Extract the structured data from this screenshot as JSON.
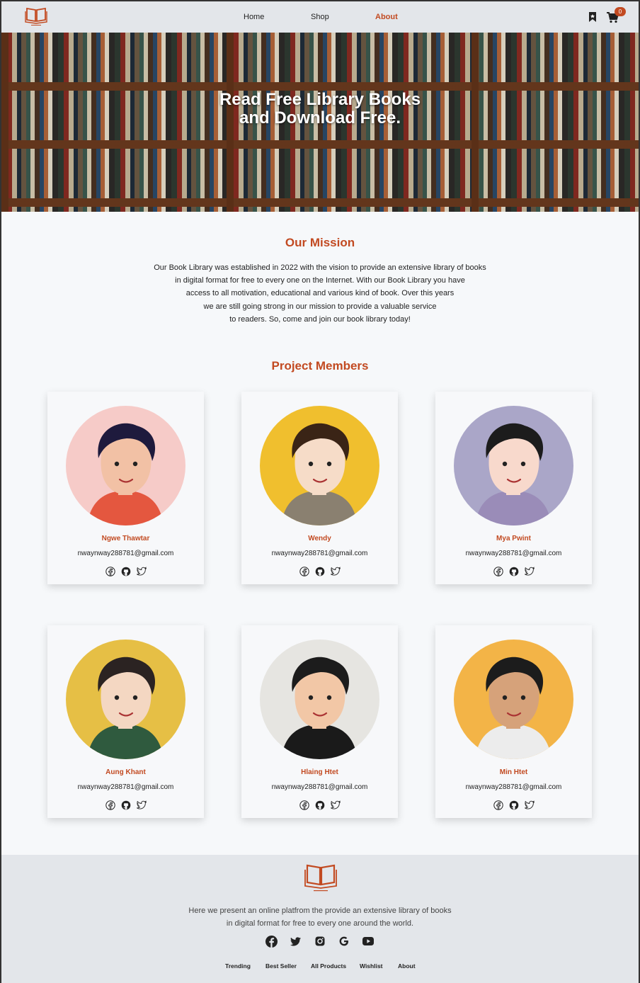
{
  "nav": {
    "links": [
      {
        "label": "Home"
      },
      {
        "label": "Shop"
      },
      {
        "label": "About"
      }
    ],
    "cart_count": "0",
    "icons": [
      "book-logo-icon",
      "bookmark-icon",
      "cart-icon"
    ]
  },
  "hero": {
    "title": "Read Free Library Books and Download Free."
  },
  "mission": {
    "title": "Our Mission",
    "lines": [
      "Our Book Library was established in 2022 with the vision to provide an extensive library of books",
      "in digital format for free to every one on the Internet. With our Book Library you have",
      "access to all motivation, educational and various kind of book. Over this years",
      "we are still going strong in our mission to provide a valuable service",
      "to readers. So, come and join our book library today!"
    ]
  },
  "members": {
    "title": "Project Members",
    "items": [
      {
        "name": "Ngwe Thawtar",
        "email": "nwaynway288781@gmail.com",
        "bg": "#f6cbc8"
      },
      {
        "name": "Wendy",
        "email": "nwaynway288781@gmail.com",
        "bg": "#f0bf2e"
      },
      {
        "name": "Mya Pwint",
        "email": "nwaynway288781@gmail.com",
        "bg": "#aaa6c8"
      },
      {
        "name": "Aung Khant",
        "email": "nwaynway288781@gmail.com",
        "bg": "#e6bf45"
      },
      {
        "name": "Hlaing Htet",
        "email": "nwaynway288781@gmail.com",
        "bg": "#e6e5e1"
      },
      {
        "name": "Min Htet",
        "email": "nwaynway288781@gmail.com",
        "bg": "#f3b447"
      }
    ],
    "social_icons": [
      "facebook-icon",
      "github-icon",
      "twitter-icon"
    ]
  },
  "footer": {
    "lines": [
      "Here we present an online platfrom the provide an extensive library of books",
      "in digital format for free to every one around the world."
    ],
    "social_icons": [
      "facebook-icon",
      "twitter-icon",
      "instagram-icon",
      "google-icon",
      "youtube-icon"
    ],
    "links": [
      {
        "label": "Trending"
      },
      {
        "label": "Best Seller"
      },
      {
        "label": "All Products"
      },
      {
        "label": "Wishlist"
      },
      {
        "label": "About"
      }
    ]
  },
  "colors": {
    "accent": "#c24a21",
    "nav_bg": "#e3e6ea",
    "page_bg": "#f6f8fa"
  }
}
